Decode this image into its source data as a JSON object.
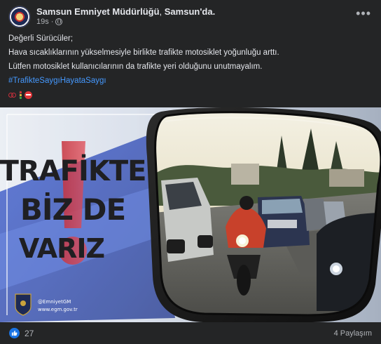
{
  "post": {
    "author": "Samsun Emniyet Müdürlüğü",
    "location": "Samsun'da.",
    "time": "19s",
    "more_icon": "ellipsis-icon",
    "privacy_icon": "globe-icon"
  },
  "body": {
    "greeting": "Değerli Sürücüler;",
    "line1": "Hava sıcaklıklarının yükselmesiyle birlikte trafikte motosiklet yoğunluğu arttı.",
    "line2": "Lütfen motosiklet kullanıcılarının da trafikte yeri olduğunu unutmayalım.",
    "hashtag": "#TrafikteSaygıHayataSaygı",
    "emojis": [
      "motorcycle-emoji",
      "traffic-light-emoji",
      "no-entry-emoji"
    ]
  },
  "image": {
    "headline": [
      "TRAFİKTE",
      "BİZ DE",
      "VARIZ"
    ],
    "handle": "@EmniyetGM",
    "website": "www.egm.gov.tr"
  },
  "footer": {
    "like_count": "27",
    "shares": "4 Paylaşım"
  },
  "colors": {
    "background": "#242526",
    "link": "#4599ff",
    "like_badge": "#1b74e4"
  }
}
